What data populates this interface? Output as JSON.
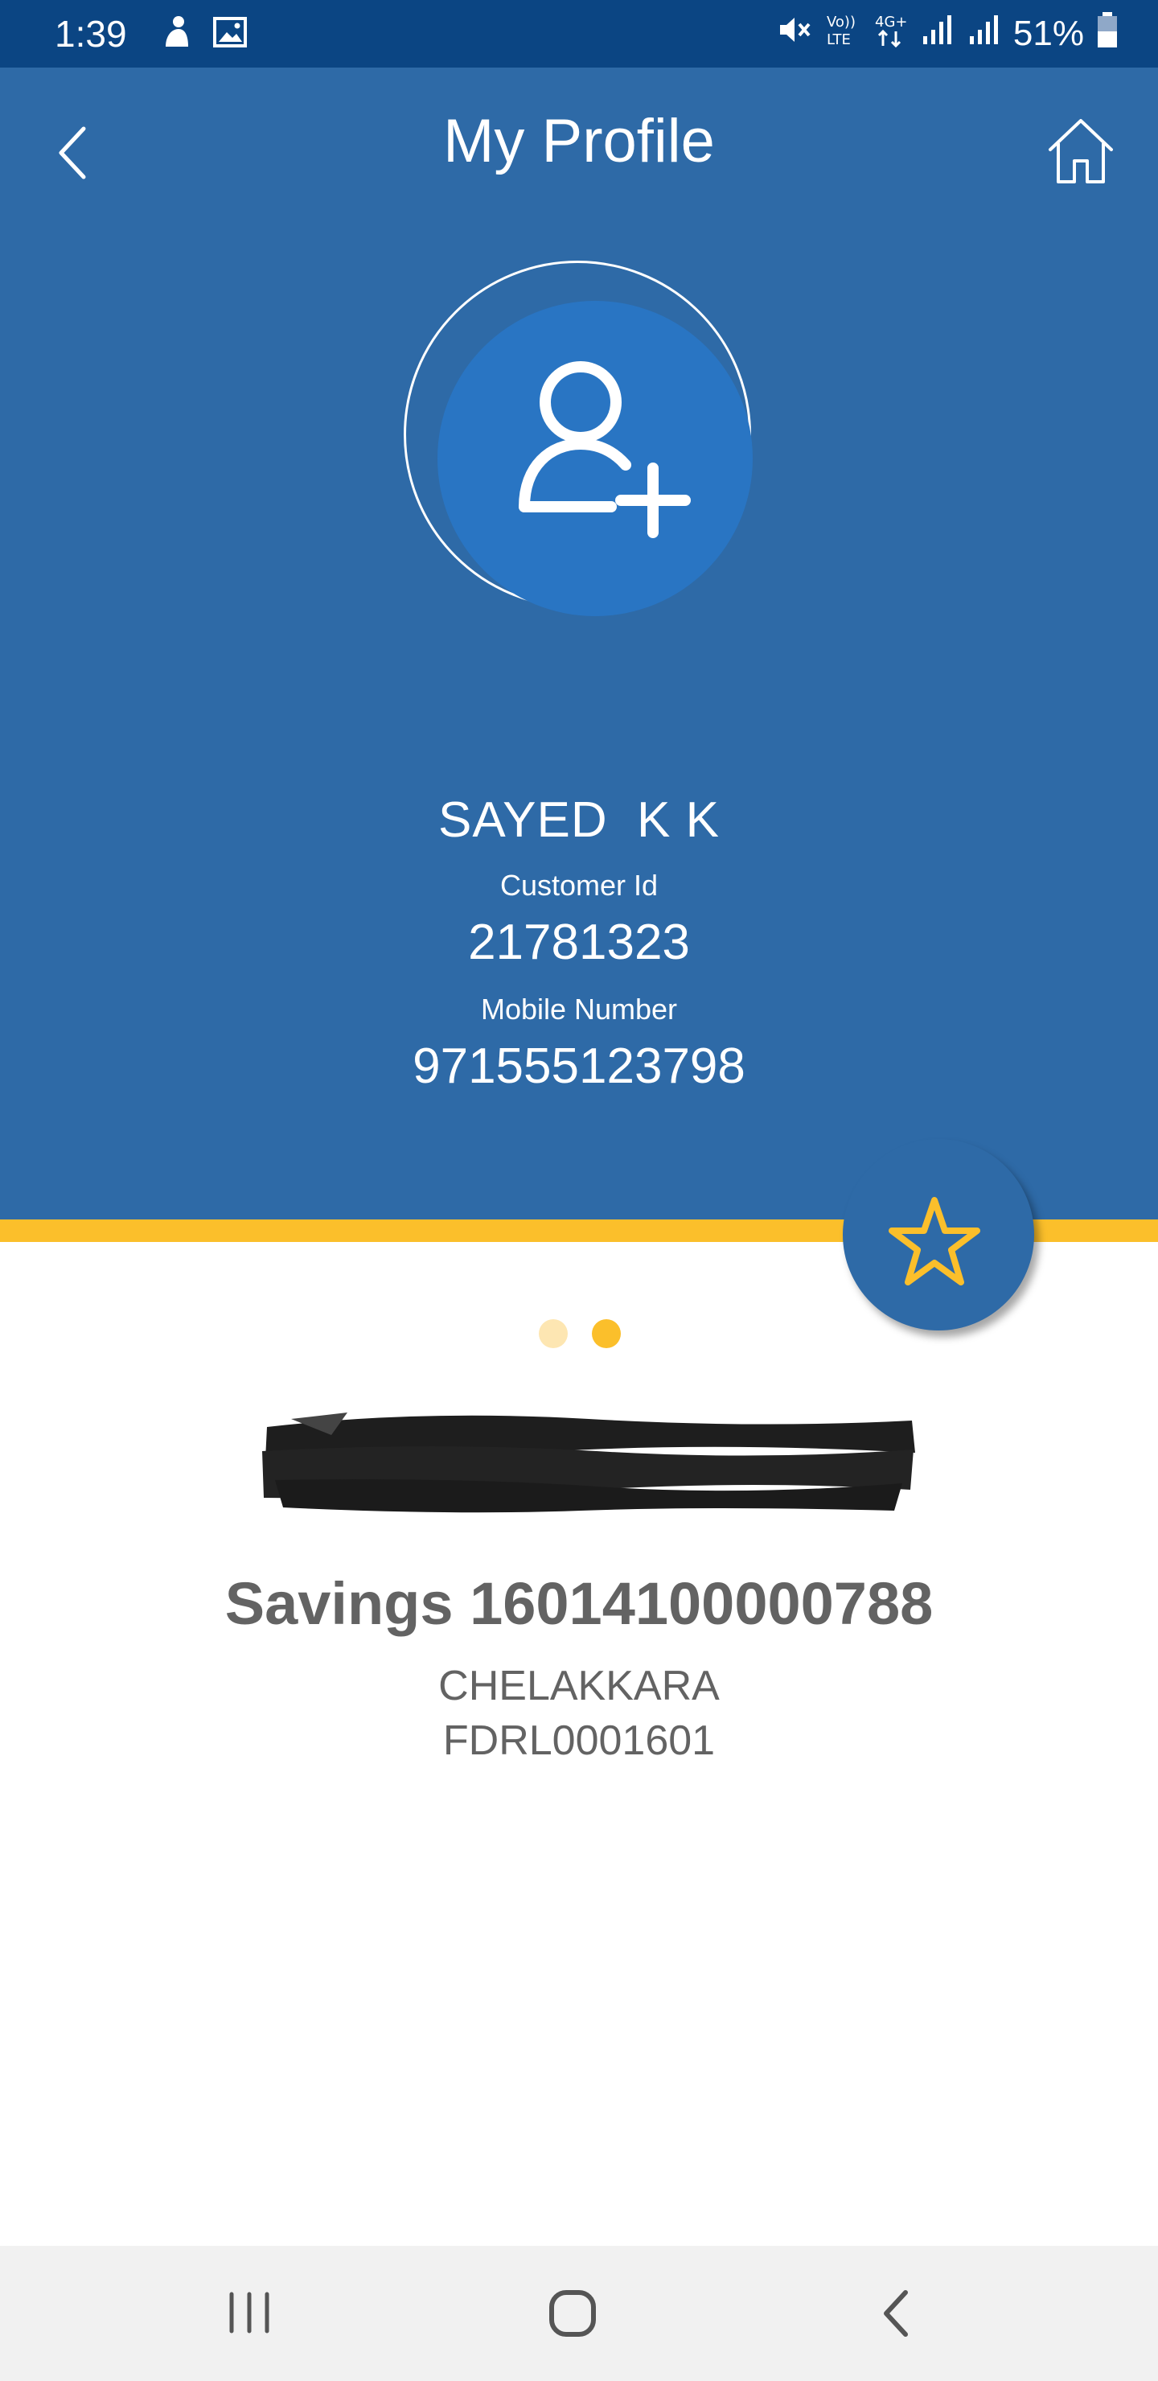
{
  "status_bar": {
    "time": "1:39",
    "battery": "51%"
  },
  "header": {
    "title": "My Profile"
  },
  "profile": {
    "name": "SAYED  K K",
    "customer_id_label": "Customer Id",
    "customer_id": "21781323",
    "mobile_label": "Mobile Number",
    "mobile_number": "971555123798"
  },
  "carousel": {
    "total_pages": 2,
    "active_page": 2
  },
  "account": {
    "number_line": "Savings 16014100000788",
    "branch": "CHELAKKARA",
    "ifsc": "FDRL0001601"
  },
  "colors": {
    "status_bar": "#0b4583",
    "header_blue": "#2e6aa7",
    "avatar_blue": "#2975c3",
    "accent_yellow": "#fbbf2b",
    "account_text": "#636363"
  },
  "icons": {
    "back": "chevron-left-icon",
    "home": "home-icon",
    "avatar": "add-user-icon",
    "favorite": "star-icon"
  }
}
